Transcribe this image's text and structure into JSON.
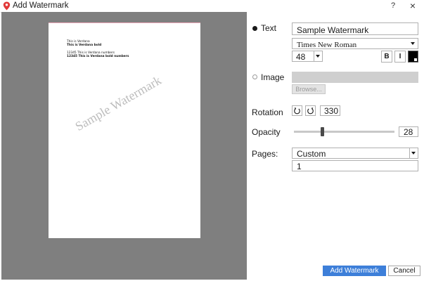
{
  "window": {
    "title": "Add Watermark",
    "help_label": "?",
    "close_label": "×"
  },
  "preview": {
    "lines": [
      "This is Verdana",
      "This is Verdana bold",
      "12345 This is Verdana numbers",
      "12345 This is Verdana bold numbers"
    ],
    "watermark_text": "Sample Watermark"
  },
  "settings": {
    "text_option_label": "Text",
    "text_value": "Sample Watermark",
    "font_value": "Times New Roman",
    "size_value": "48",
    "bold_label": "B",
    "italic_label": "I",
    "color": "#000000",
    "image_option_label": "Image",
    "browse_label": "Browse...",
    "rotation_label": "Rotation",
    "rotation_value": "330",
    "opacity_label": "Opacity",
    "opacity_value": "28",
    "pages_label": "Pages:",
    "pages_mode": "Custom",
    "pages_value": "1"
  },
  "footer": {
    "add_label": "Add Watermark",
    "cancel_label": "Cancel"
  },
  "colors": {
    "preview_bg": "#7f7f7f",
    "accent": "#3d7fd9",
    "watermark": "#bdbdbd"
  },
  "icons": {
    "app": "pin-icon",
    "rotate_left": "rotate-left-icon",
    "rotate_right": "rotate-right-icon"
  }
}
